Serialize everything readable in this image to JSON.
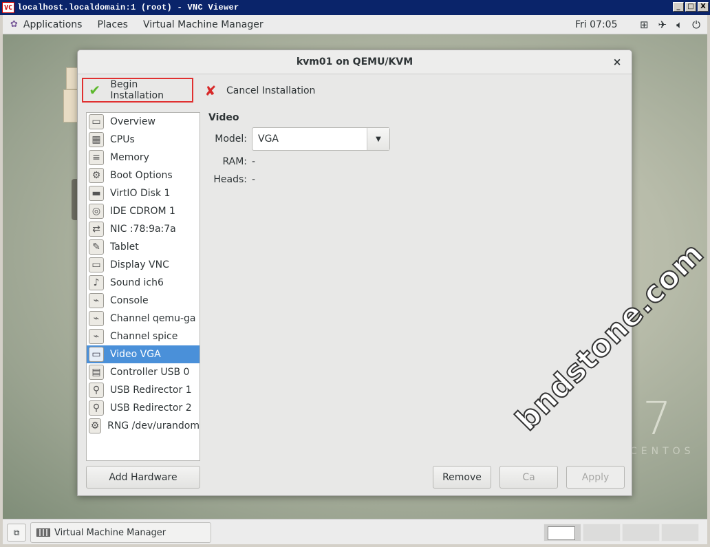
{
  "vnc": {
    "title": "localhost.localdomain:1 (root) - VNC Viewer",
    "logo": "VC",
    "buttons": [
      "_",
      "□",
      "X"
    ]
  },
  "topbar": {
    "applications": "Applications",
    "places": "Places",
    "vmm": "Virtual Machine Manager",
    "clock": "Fri 07:05",
    "tray_icons": [
      "network-icon",
      "airplane-icon",
      "volume-icon",
      "power-icon"
    ]
  },
  "dialog": {
    "title": "kvm01 on QEMU/KVM",
    "close": "×",
    "begin_installation": "Begin Installation",
    "cancel_installation": "Cancel Installation"
  },
  "hardware": [
    {
      "label": "Overview",
      "icon": "monitor-icon",
      "glyph": "▭"
    },
    {
      "label": "CPUs",
      "icon": "cpu-icon",
      "glyph": "▦"
    },
    {
      "label": "Memory",
      "icon": "memory-icon",
      "glyph": "≡"
    },
    {
      "label": "Boot Options",
      "icon": "gears-icon",
      "glyph": "⚙"
    },
    {
      "label": "VirtIO Disk 1",
      "icon": "disk-icon",
      "glyph": "▬"
    },
    {
      "label": "IDE CDROM 1",
      "icon": "cdrom-icon",
      "glyph": "◎"
    },
    {
      "label": "NIC :78:9a:7a",
      "icon": "network-card-icon",
      "glyph": "⇄"
    },
    {
      "label": "Tablet",
      "icon": "tablet-icon",
      "glyph": "✎"
    },
    {
      "label": "Display VNC",
      "icon": "display-icon",
      "glyph": "▭"
    },
    {
      "label": "Sound ich6",
      "icon": "sound-card-icon",
      "glyph": "♪"
    },
    {
      "label": "Console",
      "icon": "serial-icon",
      "glyph": "⌁"
    },
    {
      "label": "Channel qemu-ga",
      "icon": "channel-icon",
      "glyph": "⌁"
    },
    {
      "label": "Channel spice",
      "icon": "channel-icon",
      "glyph": "⌁"
    },
    {
      "label": "Video VGA",
      "icon": "video-card-icon",
      "glyph": "▭",
      "selected": true
    },
    {
      "label": "Controller USB 0",
      "icon": "controller-icon",
      "glyph": "▤"
    },
    {
      "label": "USB Redirector 1",
      "icon": "usb-icon",
      "glyph": "⚲"
    },
    {
      "label": "USB Redirector 2",
      "icon": "usb-icon",
      "glyph": "⚲"
    },
    {
      "label": "RNG /dev/urandom",
      "icon": "gears-icon",
      "glyph": "⚙"
    }
  ],
  "add_hardware": "Add Hardware",
  "details": {
    "section_title": "Video",
    "model_label": "Model:",
    "model_value": "VGA",
    "ram_label": "RAM:",
    "ram_value": "-",
    "heads_label": "Heads:",
    "heads_value": "-"
  },
  "buttons": {
    "remove": "Remove",
    "cancel": "Ca",
    "apply": "Apply"
  },
  "desktop": {
    "centos_number": "7",
    "centos_word": "CENTOS"
  },
  "watermark": "bndstone.com",
  "taskbar": {
    "window_label": "Virtual Machine Manager"
  }
}
